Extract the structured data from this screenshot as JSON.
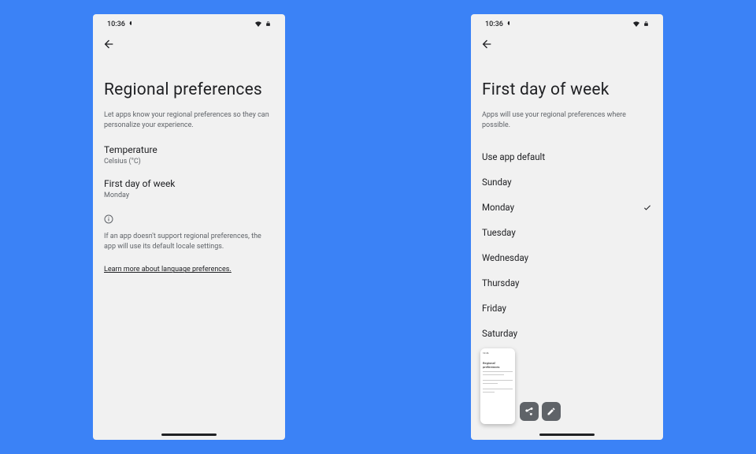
{
  "status": {
    "time": "10:36"
  },
  "left": {
    "title": "Regional preferences",
    "subtitle": "Let apps know your regional preferences so they can personalize your experience.",
    "temperature": {
      "label": "Temperature",
      "value": "Celsius (°C)"
    },
    "firstday": {
      "label": "First day of week",
      "value": "Monday"
    },
    "info": "If an app doesn't support regional preferences, the app will use its default locale settings.",
    "link": "Learn more about language preferences."
  },
  "right": {
    "title": "First day of week",
    "subtitle": "Apps will use your regional preferences where possible.",
    "options": [
      "Use app default",
      "Sunday",
      "Monday",
      "Tuesday",
      "Wednesday",
      "Thursday",
      "Friday",
      "Saturday"
    ],
    "selected": "Monday"
  },
  "thumb": {
    "title": "Regional preferences"
  }
}
